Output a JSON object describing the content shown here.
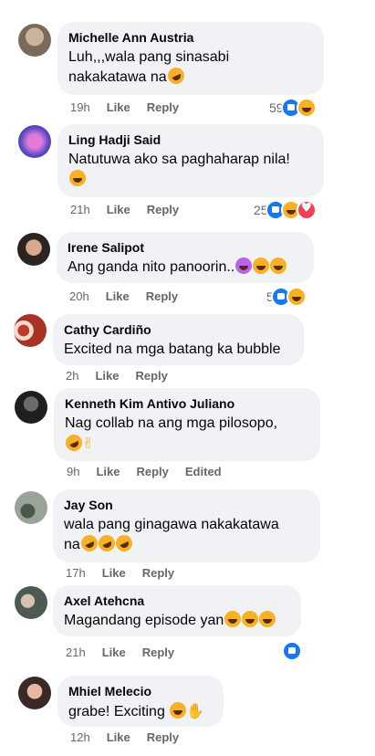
{
  "actions": {
    "like": "Like",
    "reply": "Reply",
    "edited": "Edited"
  },
  "comments": [
    {
      "name": "Michelle Ann Austria",
      "line1": "Luh,,,wala pang sinasabi",
      "line2": "nakakatawa na",
      "time": "19h",
      "count": "59"
    },
    {
      "name": "Ling Hadji Said",
      "line1": "Natutuwa ako sa paghaharap nila!",
      "time": "21h",
      "count": "25"
    },
    {
      "name": "Irene Salipot",
      "line1": "Ang ganda nito panoorin..",
      "time": "20h",
      "count": "5"
    },
    {
      "name": "Cathy Cardiño",
      "line1": "Excited na mga batang ka bubble",
      "time": "2h"
    },
    {
      "name": "Kenneth Kim Antivo Juliano",
      "line1": "Nag collab na ang mga pilosopo,",
      "time": "9h"
    },
    {
      "name": "Jay Son",
      "line1": "wala pang ginagawa nakakatawa",
      "line2": "na",
      "time": "17h"
    },
    {
      "name": "Axel Atehcna",
      "line1": "Magandang episode yan",
      "time": "21h"
    },
    {
      "name": "Mhiel Melecio",
      "line1": "grabe! Exciting ",
      "time": "12h"
    }
  ],
  "icons": {
    "like_reaction": "like-reaction-icon",
    "haha_reaction": "haha-reaction-icon",
    "love_reaction": "love-reaction-icon"
  },
  "colors": {
    "like_blue": "#1877f2",
    "bubble_gray": "#f0f2f5",
    "meta_gray": "#65676b"
  }
}
